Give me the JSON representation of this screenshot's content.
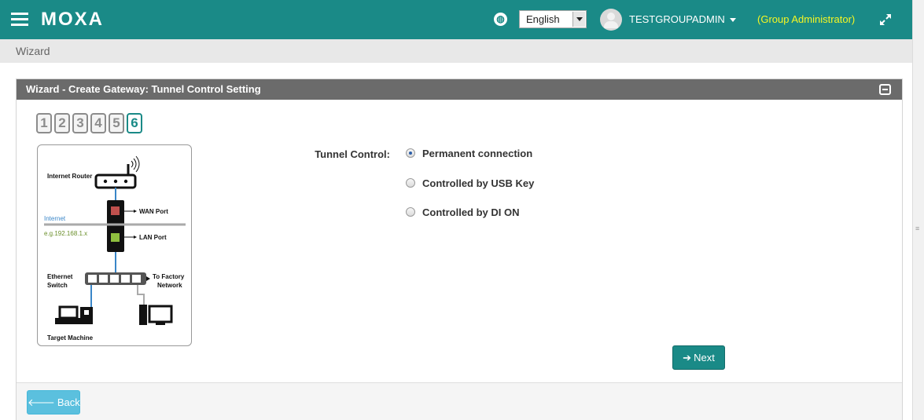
{
  "header": {
    "logo": "MOXA",
    "language": "English",
    "username": "TESTGROUPADMIN",
    "role": "(Group Administrator)"
  },
  "breadcrumb": "Wizard",
  "panel": {
    "title": "Wizard - Create Gateway: Tunnel Control Setting"
  },
  "steps": [
    "1",
    "2",
    "3",
    "4",
    "5",
    "6"
  ],
  "active_step": "6",
  "diagram": {
    "internet_router": "Internet Router",
    "wan_port": "WAN Port",
    "internet": "Internet",
    "ip_example": "e.g.192.168.1.x",
    "lan_port": "LAN Port",
    "ethernet": "Ethernet",
    "switch": "Switch",
    "to_factory": "To Factory",
    "network": "Network",
    "target_machine": "Target Machine"
  },
  "form": {
    "label": "Tunnel Control:",
    "options": [
      {
        "label": "Permanent connection",
        "checked": true
      },
      {
        "label": "Controlled by USB Key",
        "checked": false
      },
      {
        "label": "Controlled by DI ON",
        "checked": false
      }
    ]
  },
  "buttons": {
    "next": "Next",
    "back": "Back"
  },
  "colors": {
    "brand": "#1a8a87",
    "role_text": "#f7f722",
    "back_button": "#5bc0de",
    "panel_header": "#6b6b6b"
  }
}
